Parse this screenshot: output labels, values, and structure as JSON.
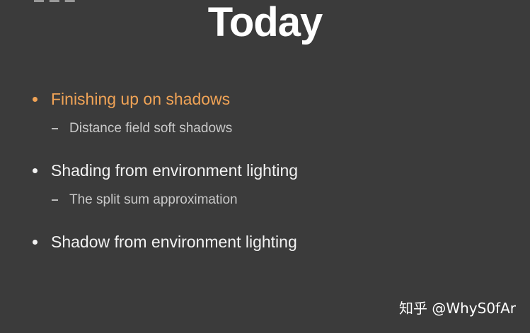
{
  "slide": {
    "title": "Today",
    "items": [
      {
        "text": "Finishing up on shadows",
        "highlighted": true,
        "sub": [
          "Distance field soft shadows"
        ]
      },
      {
        "text": "Shading from environment lighting",
        "highlighted": false,
        "sub": [
          "The split sum approximation"
        ]
      },
      {
        "text": "Shadow from environment lighting",
        "highlighted": false,
        "sub": []
      }
    ]
  },
  "watermark": "知乎 @WhyS0fAr",
  "colors": {
    "background": "#3b3b3b",
    "accent": "#f0a356",
    "text": "#f2f2f2",
    "subtext": "#c9c9c9"
  }
}
